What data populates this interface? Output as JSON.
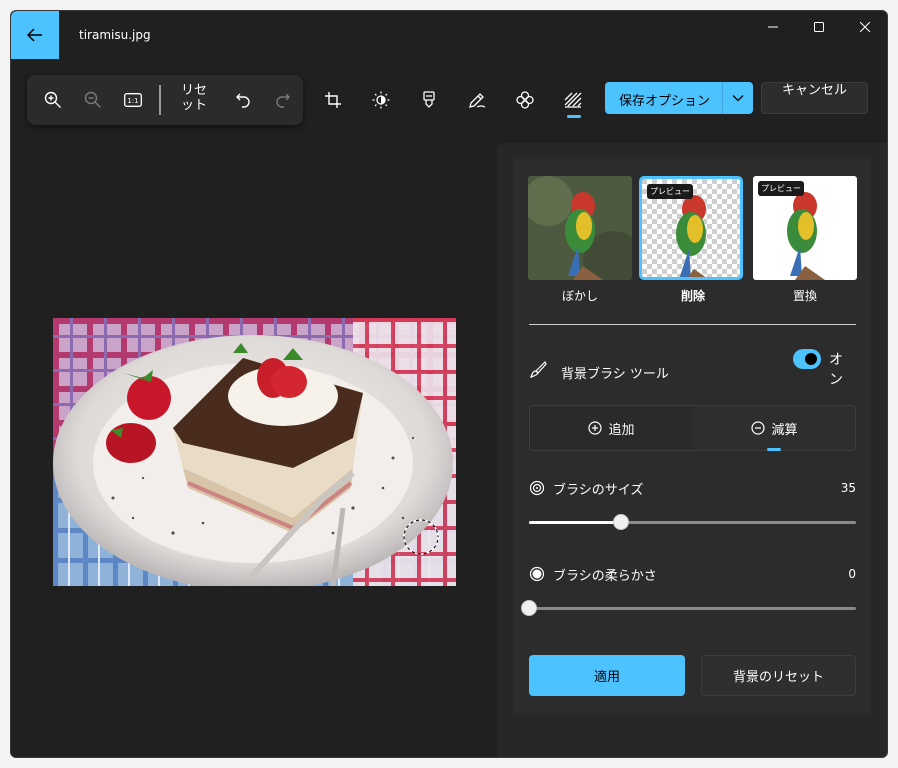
{
  "window": {
    "title": "tiramisu.jpg"
  },
  "toolbar": {
    "reset_label": "リセット",
    "save_label": "保存オプション",
    "cancel_label": "キャンセル"
  },
  "panel": {
    "thumbnails": [
      {
        "label": "ぼかし",
        "badge": ""
      },
      {
        "label": "削除",
        "badge": "プレビュー"
      },
      {
        "label": "置換",
        "badge": "プレビュー"
      }
    ],
    "brush_tool_label": "背景ブラシ ツール",
    "brush_toggle_text": "オン",
    "add_label": "追加",
    "subtract_label": "減算",
    "brush_size_label": "ブラシのサイズ",
    "brush_size_value": "35",
    "brush_size_fraction": 0.28,
    "brush_softness_label": "ブラシの柔らかさ",
    "brush_softness_value": "0",
    "brush_softness_fraction": 0,
    "apply_label": "適用",
    "background_reset_label": "背景のリセット"
  },
  "colors": {
    "accent": "#4cc2ff",
    "background": "#202020"
  }
}
